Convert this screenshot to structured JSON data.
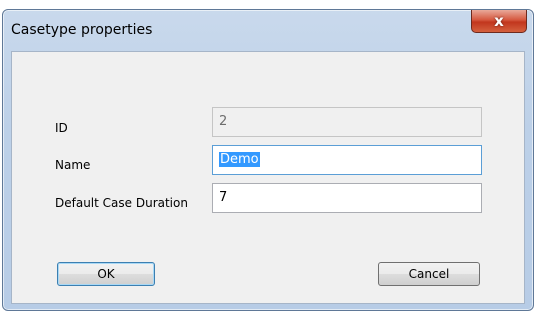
{
  "window": {
    "title": "Casetype properties",
    "close_glyph": "x"
  },
  "form": {
    "id_label": "ID",
    "id_value": "2",
    "name_label": "Name",
    "name_value": "Demo",
    "duration_label": "Default Case Duration",
    "duration_value": "7"
  },
  "buttons": {
    "ok_label": "OK",
    "cancel_label": "Cancel"
  }
}
